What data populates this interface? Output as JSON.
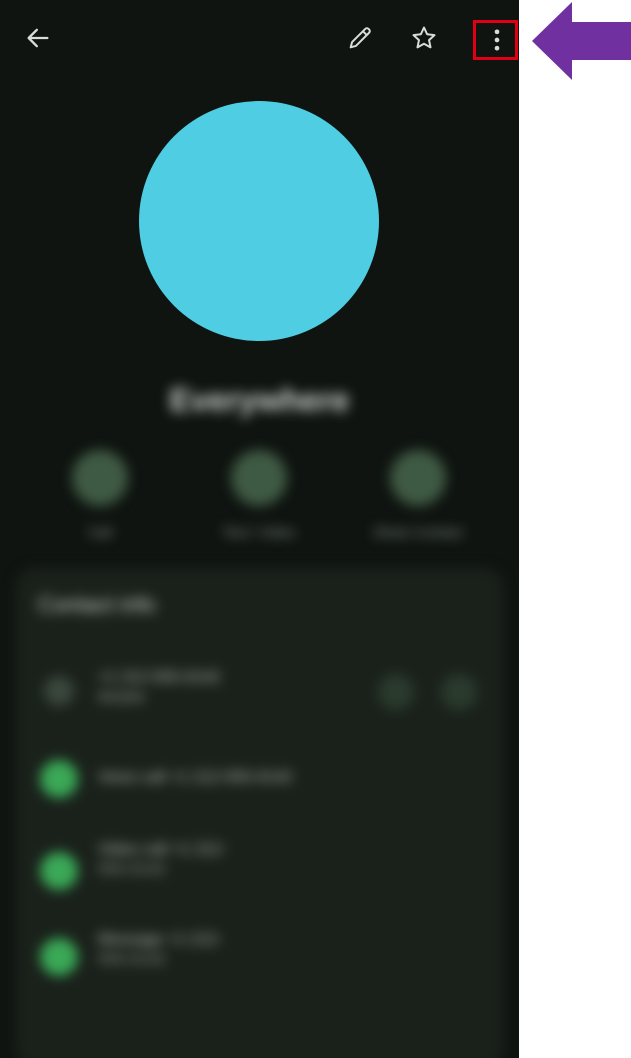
{
  "top_bar": {
    "back_icon": "arrow-left-icon",
    "edit_icon": "pencil-icon",
    "star_icon": "star-outline-icon",
    "more_icon": "more-vert-icon"
  },
  "contact": {
    "avatar_color": "#4ecde3",
    "name": "Everywhere"
  },
  "actions": [
    {
      "label": "Call",
      "icon": "phone-icon"
    },
    {
      "label": "Text / Video",
      "icon": "message-icon"
    },
    {
      "label": "Share Contact",
      "icon": "share-icon"
    }
  ],
  "card": {
    "title": "Contact info",
    "rows": [
      {
        "main": "+1 212-555-0142",
        "sub": "Mobile",
        "icon": "phone-icon"
      },
      {
        "main": "Voice call +1 212-555-0142",
        "sub": "",
        "icon": "app-icon"
      },
      {
        "main": "Video call +1 212-",
        "sub": "555-0142",
        "icon": "app-icon"
      },
      {
        "main": "Message +1 212-",
        "sub": "555-0142",
        "icon": "app-icon"
      }
    ]
  },
  "annotation": {
    "highlight_color": "#e0000f",
    "arrow_color": "#7030a0"
  }
}
